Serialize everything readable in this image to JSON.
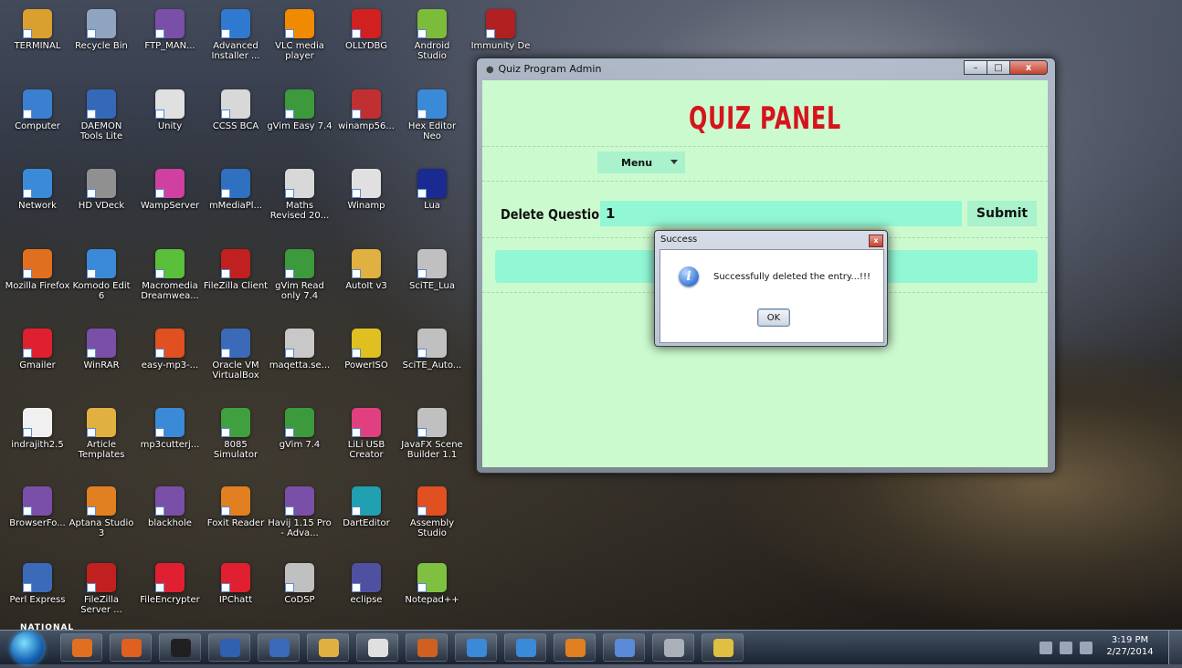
{
  "desktop": {
    "icons": [
      {
        "label": "TERMINAL",
        "color": "#d9a030"
      },
      {
        "label": "Recycle Bin",
        "color": "#8fa4bf"
      },
      {
        "label": "FTP_MAN...",
        "color": "#7a4fa8"
      },
      {
        "label": "Advanced Installer ...",
        "color": "#2f7ad0"
      },
      {
        "label": "VLC media player",
        "color": "#f08a00"
      },
      {
        "label": "OLLYDBG",
        "color": "#d02020"
      },
      {
        "label": "Android Studio",
        "color": "#7dbb3a"
      },
      {
        "label": "Immunity De",
        "color": "#b02020"
      },
      {
        "label": "Computer",
        "color": "#3a7fd0"
      },
      {
        "label": "DAEMON Tools Lite",
        "color": "#3568b8"
      },
      {
        "label": "Unity",
        "color": "#e0e0e0"
      },
      {
        "label": "CCSS BCA",
        "color": "#d8d8d8"
      },
      {
        "label": "gVim Easy 7.4",
        "color": "#3c9a3c"
      },
      {
        "label": "winamp56...",
        "color": "#c03030"
      },
      {
        "label": "Hex Editor Neo",
        "color": "#3a8ad8"
      },
      {
        "label": "Network",
        "color": "#3a8ad8"
      },
      {
        "label": "HD VDeck",
        "color": "#909090"
      },
      {
        "label": "WampServer",
        "color": "#d040a0"
      },
      {
        "label": "mMediaPl...",
        "color": "#3070c0"
      },
      {
        "label": "Maths Revised 20...",
        "color": "#d8d8d8"
      },
      {
        "label": "Winamp",
        "color": "#e0e0e0"
      },
      {
        "label": "Lua",
        "color": "#1a2a90"
      },
      {
        "label": "Mozilla Firefox",
        "color": "#e07020"
      },
      {
        "label": "Komodo Edit 6",
        "color": "#3a8ad8"
      },
      {
        "label": "Macromedia Dreamwea...",
        "color": "#5abf3a"
      },
      {
        "label": "FileZilla Client",
        "color": "#c02020"
      },
      {
        "label": "gVim Read only 7.4",
        "color": "#3c9a3c"
      },
      {
        "label": "AutoIt v3",
        "color": "#e0b040"
      },
      {
        "label": "SciTE_Lua",
        "color": "#c0c0c0"
      },
      {
        "label": "Gmailer",
        "color": "#e02030"
      },
      {
        "label": "WinRAR",
        "color": "#7a4fa8"
      },
      {
        "label": "easy-mp3-...",
        "color": "#e05020"
      },
      {
        "label": "Oracle VM VirtualBox",
        "color": "#3a6ab8"
      },
      {
        "label": "maqetta.se...",
        "color": "#c8c8c8"
      },
      {
        "label": "PowerISO",
        "color": "#e0c020"
      },
      {
        "label": "SciTE_Auto...",
        "color": "#c0c0c0"
      },
      {
        "label": "indrajith2.5",
        "color": "#f0f0f0"
      },
      {
        "label": "Article Templates",
        "color": "#e0b040"
      },
      {
        "label": "mp3cutterj...",
        "color": "#3a8ad8"
      },
      {
        "label": "8085 Simulator",
        "color": "#40a040"
      },
      {
        "label": "gVim 7.4",
        "color": "#3c9a3c"
      },
      {
        "label": "LiLi USB Creator",
        "color": "#e04080"
      },
      {
        "label": "JavaFX Scene Builder 1.1",
        "color": "#c0c0c0"
      },
      {
        "label": "BrowserFo...",
        "color": "#7a4fa8"
      },
      {
        "label": "Aptana Studio 3",
        "color": "#e08020"
      },
      {
        "label": "blackhole",
        "color": "#7a4fa8"
      },
      {
        "label": "Foxit Reader",
        "color": "#e08020"
      },
      {
        "label": "Havij 1.15 Pro - Adva...",
        "color": "#7a4fa8"
      },
      {
        "label": "DartEditor",
        "color": "#20a0b0"
      },
      {
        "label": "Assembly Studio",
        "color": "#e05020"
      },
      {
        "label": "Perl Express",
        "color": "#3a6ab8"
      },
      {
        "label": "FileZilla Server ...",
        "color": "#c02020"
      },
      {
        "label": "FileEncrypter",
        "color": "#e02030"
      },
      {
        "label": "IPChatt",
        "color": "#e02030"
      },
      {
        "label": "CoDSP",
        "color": "#c0c0c0"
      },
      {
        "label": "eclipse",
        "color": "#5050a0"
      },
      {
        "label": "Notepad++",
        "color": "#80c040"
      }
    ],
    "partial_label": "NATIONAL"
  },
  "window": {
    "title": "Quiz Program Admin",
    "minimize": "–",
    "maximize": "□",
    "close": "x"
  },
  "quiz": {
    "panel_title": "QUIZ PANEL",
    "menu_label": "Menu",
    "delete_label": "Delete Question:",
    "delete_value": "1",
    "submit_label": "Submit"
  },
  "dialog": {
    "title": "Success",
    "close": "x",
    "message": "Successfully deleted the entry...!!!",
    "ok_label": "OK"
  },
  "taskbar": {
    "items": [
      {
        "name": "firefox",
        "color": "#e07020"
      },
      {
        "name": "media-player",
        "color": "#e06020"
      },
      {
        "name": "command-prompt",
        "color": "#202020"
      },
      {
        "name": "visual-studio",
        "color": "#3060b0"
      },
      {
        "name": "virtualbox",
        "color": "#3a6ab8"
      },
      {
        "name": "file-explorer",
        "color": "#e0b040"
      },
      {
        "name": "winamp",
        "color": "#e0e0e0"
      },
      {
        "name": "matlab",
        "color": "#d06020"
      },
      {
        "name": "livecode",
        "color": "#3a8ad8"
      },
      {
        "name": "remote-desktop",
        "color": "#3a8ad8"
      },
      {
        "name": "foxit-pdf",
        "color": "#e08020"
      },
      {
        "name": "notes",
        "color": "#5a8ad8"
      },
      {
        "name": "apple-app",
        "color": "#aab0ba"
      },
      {
        "name": "paint",
        "color": "#e0c040"
      }
    ],
    "time": "3:19 PM",
    "date": "2/27/2014"
  }
}
